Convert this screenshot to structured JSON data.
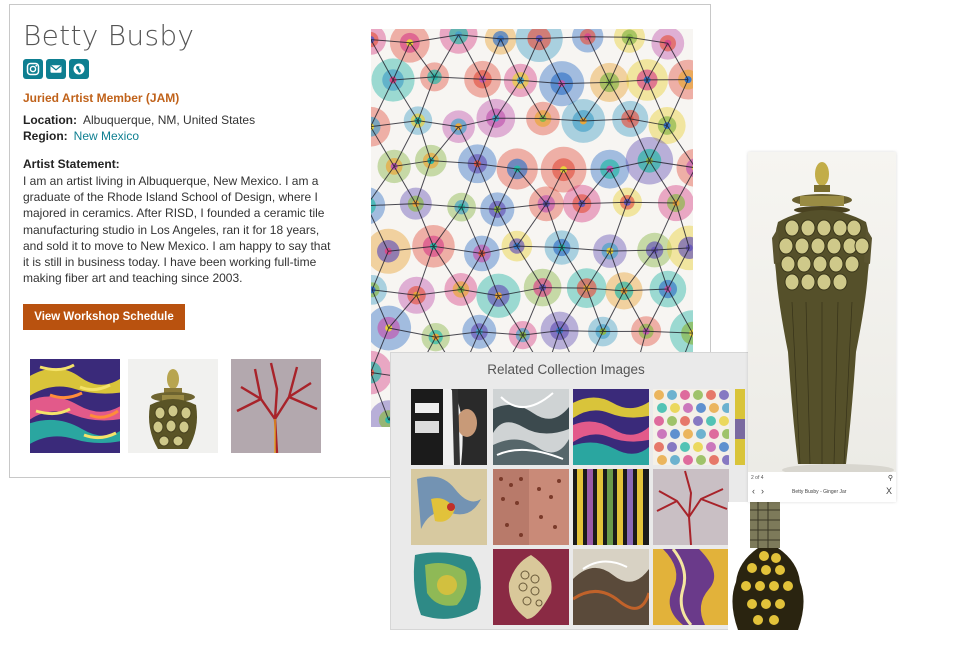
{
  "profile": {
    "name": "Betty Busby",
    "social_icons": [
      "instagram-icon",
      "email-icon",
      "website-icon"
    ],
    "member_type": "Juried Artist Member (JAM)",
    "location_label": "Location:",
    "location_value": "Albuquerque, NM, United States",
    "region_label": "Region:",
    "region_value": "New Mexico",
    "statement_label": "Artist Statement:",
    "statement_text": "I am an artist living in Albuquerque, New Mexico. I am a graduate of the Rhode Island School of Design, where I majored in ceramics. After RISD, I founded a ceramic tile manufacturing studio in Los Angeles, ran it for 18 years, and sold it to move to New Mexico. I am happy to say that it is still in business today. I have been working full-time making fiber art and teaching since 2003.",
    "workshop_button": "View Workshop Schedule"
  },
  "related": {
    "title": "Related Collection Images"
  },
  "lightbox": {
    "counter": "2 of 4",
    "caption": "Betty Busby - Ginger Jar",
    "close": "X",
    "prev": "‹",
    "next": "›",
    "zoom": "⚲"
  },
  "colors": {
    "brand_teal": "#0e7f91",
    "accent_orange": "#c0621a",
    "button_orange": "#b9520f"
  }
}
